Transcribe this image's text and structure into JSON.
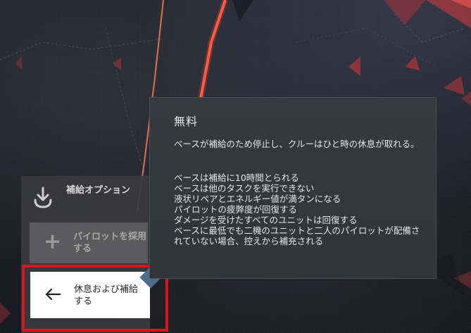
{
  "options_panel": {
    "header_label": "補給オプション",
    "hire_pilot_label": "パイロットを採用する",
    "rest_resupply_label": "休息および補給する"
  },
  "tooltip": {
    "title": "無料",
    "description": "ベースが補給のため停止し、クルーはひと時の休息が取れる。",
    "effects": [
      "ベースは補給に10時間とられる",
      "ベースは他のタスクを実行できない",
      "液状リペアとエネルギー値が満タンになる",
      "パイロットの疲弊度が回復する",
      "ダメージを受けたすべてのユニットは回復する",
      "ベースに最低でも二機のユニットと二人のパイロットが配備されていない場合、控えから補充される"
    ]
  },
  "colors": {
    "highlight": "#e0101c",
    "route_line": "#ff6a4a",
    "tooltip_bg": "#343a3f",
    "panel_bg": "#3a3a3e"
  },
  "icons": {
    "supply": "download-tray-icon",
    "hire": "plus-icon",
    "rest": "arrow-left-icon"
  }
}
